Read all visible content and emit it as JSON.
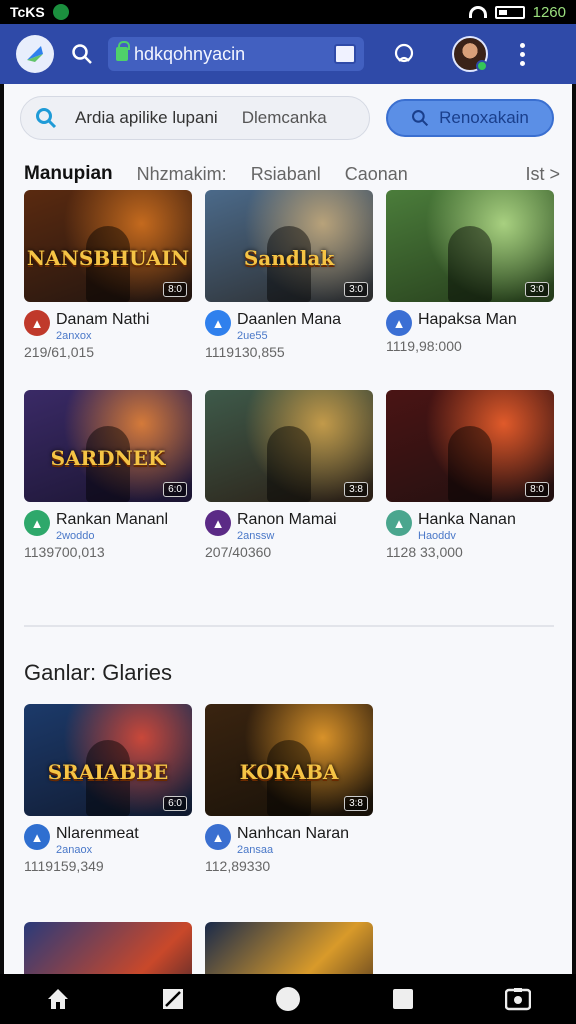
{
  "status_bar": {
    "carrier": "TcKS",
    "clock": "1260"
  },
  "header": {
    "url": "hdkqohnyacin"
  },
  "search": {
    "placeholder": "Ardia apilike lupani",
    "hint": "Dlemcanka",
    "button_label": "Renoxakain"
  },
  "tabs": [
    {
      "label": "Manupian"
    },
    {
      "label": "Nhzmakim:"
    },
    {
      "label": "Rsiabanl"
    },
    {
      "label": "Caonan"
    },
    {
      "label": "Ist >"
    }
  ],
  "videos": [
    {
      "thumb_title": "NANSBHUAIN",
      "duration": "8:0",
      "channel": "Danam Nathi",
      "badge": "2anxox",
      "views": "219/61,015",
      "colors": [
        "#5a2a10",
        "#c46a1e",
        "#1f1410"
      ],
      "icon_color": "#c0392b"
    },
    {
      "thumb_title": "Sandlak",
      "duration": "3:0",
      "channel": "Daanlen Mana",
      "badge": "2ue55",
      "views": "1119130,855",
      "colors": [
        "#4b6a8a",
        "#b8a27a",
        "#2b2b2b"
      ],
      "icon_color": "#2f80ed"
    },
    {
      "thumb_title": "",
      "duration": "3:0",
      "channel": "Hapaksa Man",
      "badge": "",
      "views": "1119,98:000",
      "colors": [
        "#4b7d3b",
        "#a8d080",
        "#243a1a"
      ],
      "icon_color": "#3b6fd4"
    },
    {
      "thumb_title": "SARDNEK",
      "duration": "6:0",
      "channel": "Rankan Mananl",
      "badge": "2woddo",
      "views": "1139700,013",
      "colors": [
        "#3a2a66",
        "#d47a3a",
        "#1a1430"
      ],
      "icon_color": "#2ea86b"
    },
    {
      "thumb_title": "",
      "duration": "3:8",
      "channel": "Ranon Mamai",
      "badge": "2anssw",
      "views": "207/40360",
      "colors": [
        "#3e5a4a",
        "#c29a4a",
        "#2a1d14"
      ],
      "icon_color": "#5b2a86"
    },
    {
      "thumb_title": "",
      "duration": "8:0",
      "channel": "Hanka Nanan",
      "badge": "Haoddv",
      "views": "1128 33,000",
      "colors": [
        "#4a1414",
        "#e05a2a",
        "#201010"
      ],
      "icon_color": "#4aa68e"
    }
  ],
  "section_title": "Ganlar: Glaries",
  "videos2": [
    {
      "thumb_title": "SRAIABBE",
      "duration": "6:0",
      "channel": "Nlarenmeat",
      "badge": "2anaox",
      "views": "1119159,349",
      "colors": [
        "#1c3a6a",
        "#c9483a",
        "#10192e"
      ],
      "icon_color": "#2f6fd0"
    },
    {
      "thumb_title": "KORABA",
      "duration": "3:8",
      "channel": "Nanhcan Naran",
      "badge": "2ansaa",
      "views": "112,89330",
      "colors": [
        "#3a2410",
        "#d8922a",
        "#161008"
      ],
      "icon_color": "#3a6fd0"
    }
  ],
  "colors": {
    "header": "#2f4aa8",
    "accent": "#5b8fe6"
  }
}
